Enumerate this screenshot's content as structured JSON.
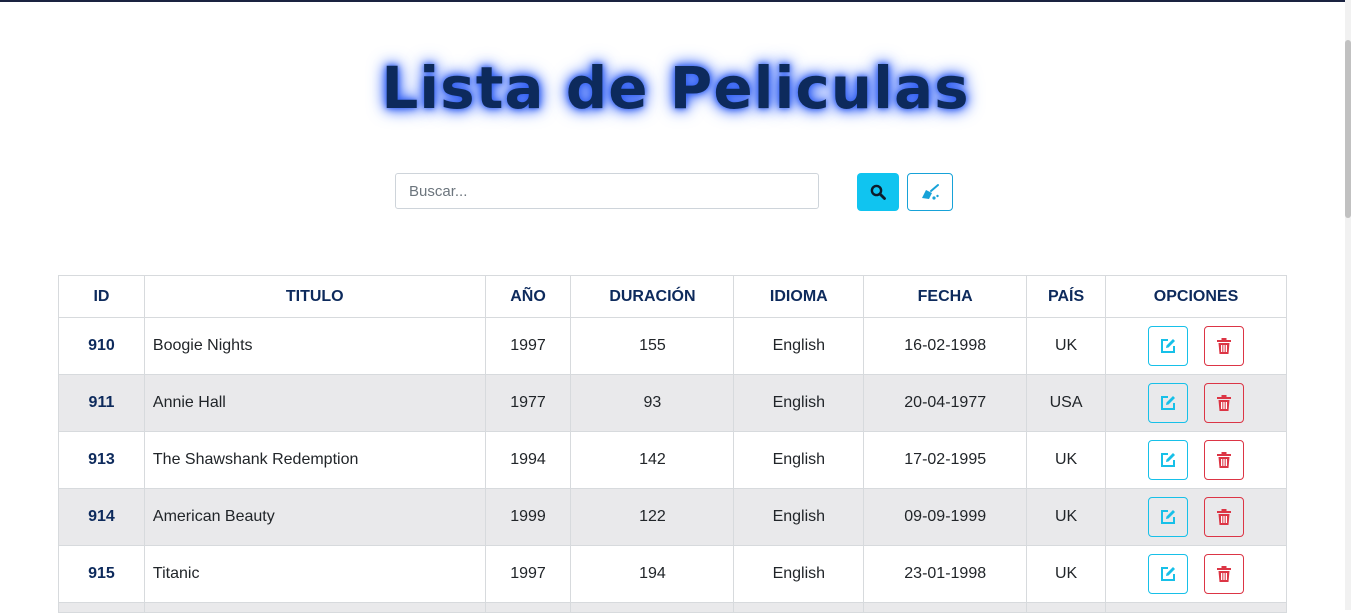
{
  "page": {
    "title": "Lista de Peliculas"
  },
  "search": {
    "placeholder": "Buscar...",
    "value": ""
  },
  "table": {
    "headers": {
      "id": "ID",
      "titulo": "TITULO",
      "anio": "AÑO",
      "duracion": "DURACIÓN",
      "idioma": "IDIOMA",
      "fecha": "FECHA",
      "pais": "PAÍS",
      "opciones": "OPCIONES"
    },
    "rows": [
      {
        "id": "910",
        "titulo": "Boogie Nights",
        "anio": "1997",
        "duracion": "155",
        "idioma": "English",
        "fecha": "16-02-1998",
        "pais": "UK"
      },
      {
        "id": "911",
        "titulo": "Annie Hall",
        "anio": "1977",
        "duracion": "93",
        "idioma": "English",
        "fecha": "20-04-1977",
        "pais": "USA"
      },
      {
        "id": "913",
        "titulo": "The Shawshank Redemption",
        "anio": "1994",
        "duracion": "142",
        "idioma": "English",
        "fecha": "17-02-1995",
        "pais": "UK"
      },
      {
        "id": "914",
        "titulo": "American Beauty",
        "anio": "1999",
        "duracion": "122",
        "idioma": "English",
        "fecha": "09-09-1999",
        "pais": "UK"
      },
      {
        "id": "915",
        "titulo": "Titanic",
        "anio": "1997",
        "duracion": "194",
        "idioma": "English",
        "fecha": "23-01-1998",
        "pais": "UK"
      }
    ]
  },
  "icons": {
    "search": "search-icon",
    "clear": "broom-icon",
    "edit": "edit-icon",
    "delete": "trash-icon"
  },
  "colors": {
    "title": "#0d2a5c",
    "title_glow": "#2f5df0",
    "info": "#10c4f0",
    "danger": "#dc3545",
    "row_alt": "#e9e9eb"
  }
}
